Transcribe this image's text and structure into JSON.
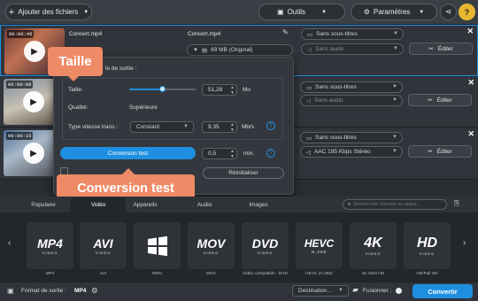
{
  "toolbar": {
    "add_files": "Ajouter des fichiers",
    "tools": "Outils",
    "settings": "Paramètres"
  },
  "files": [
    {
      "time": "00:00:46",
      "name": "Concert.mp4",
      "output_name": "Concert.mp4",
      "size": "69 MB (Original)",
      "subtitles": "Sans sous-titres",
      "audio": "Sans audio",
      "edit": "Éditer"
    },
    {
      "time": "00:00:08",
      "subtitles": "Sans sous-titres",
      "audio": "Sans audio",
      "edit": "Éditer"
    },
    {
      "time": "00:00:15",
      "subtitles": "Sans sous-titres",
      "audio": "AAC 195 Kbps Stéréo",
      "edit": "Éditer"
    }
  ],
  "panel": {
    "heading_fragment": "le de sortie :",
    "size_label": "Taille:",
    "size_value": "51,28",
    "size_unit": "Mo",
    "slider_fraction": 0.5,
    "quality_label": "Qualité:",
    "quality_value": "Supérieure",
    "speed_label": "Type vitesse trans.:",
    "speed_option": "Constant",
    "speed_value": "9,35",
    "speed_unit": "Mb/s",
    "test_button": "Conversion test",
    "duration_value": "0,5",
    "duration_unit": "min.",
    "reset_button": "Réinitialiser"
  },
  "callouts": {
    "size": "Taille",
    "test": "Conversion test"
  },
  "tabs": [
    "Populaire",
    "Vidéo",
    "Appareils",
    "Audio",
    "Images"
  ],
  "active_tab": "Vidéo",
  "search_placeholder": "Rechercher formats ou appar...",
  "formats": [
    {
      "logo": "MP4",
      "sub": "VIDEO",
      "label": "MP4"
    },
    {
      "logo": "AVI",
      "sub": "VIDEO",
      "label": "AVI"
    },
    {
      "logo": "",
      "sub": "",
      "label": "WMV"
    },
    {
      "logo": "MOV",
      "sub": "VIDEO",
      "label": "MOV"
    },
    {
      "logo": "DVD",
      "sub": "VIDEO",
      "label": "Vidéo compatible - DVD"
    },
    {
      "logo": "HEVC",
      "sub": "H.265",
      "label": "HEVC (H.265)"
    },
    {
      "logo": "4K",
      "sub": "VIDEO",
      "label": "4K Ultra HD"
    },
    {
      "logo": "HD",
      "sub": "VIDEO",
      "label": "HD/Full HD"
    }
  ],
  "bottom": {
    "format_label": "Format de sortie :",
    "format_value": "MP4",
    "destination": "Destination...",
    "merge": "Fusionner :",
    "convert": "Convertir"
  },
  "colors": {
    "accent": "#1e8fe0",
    "callout": "#ef8a66",
    "convert": "#1e8fe0"
  }
}
